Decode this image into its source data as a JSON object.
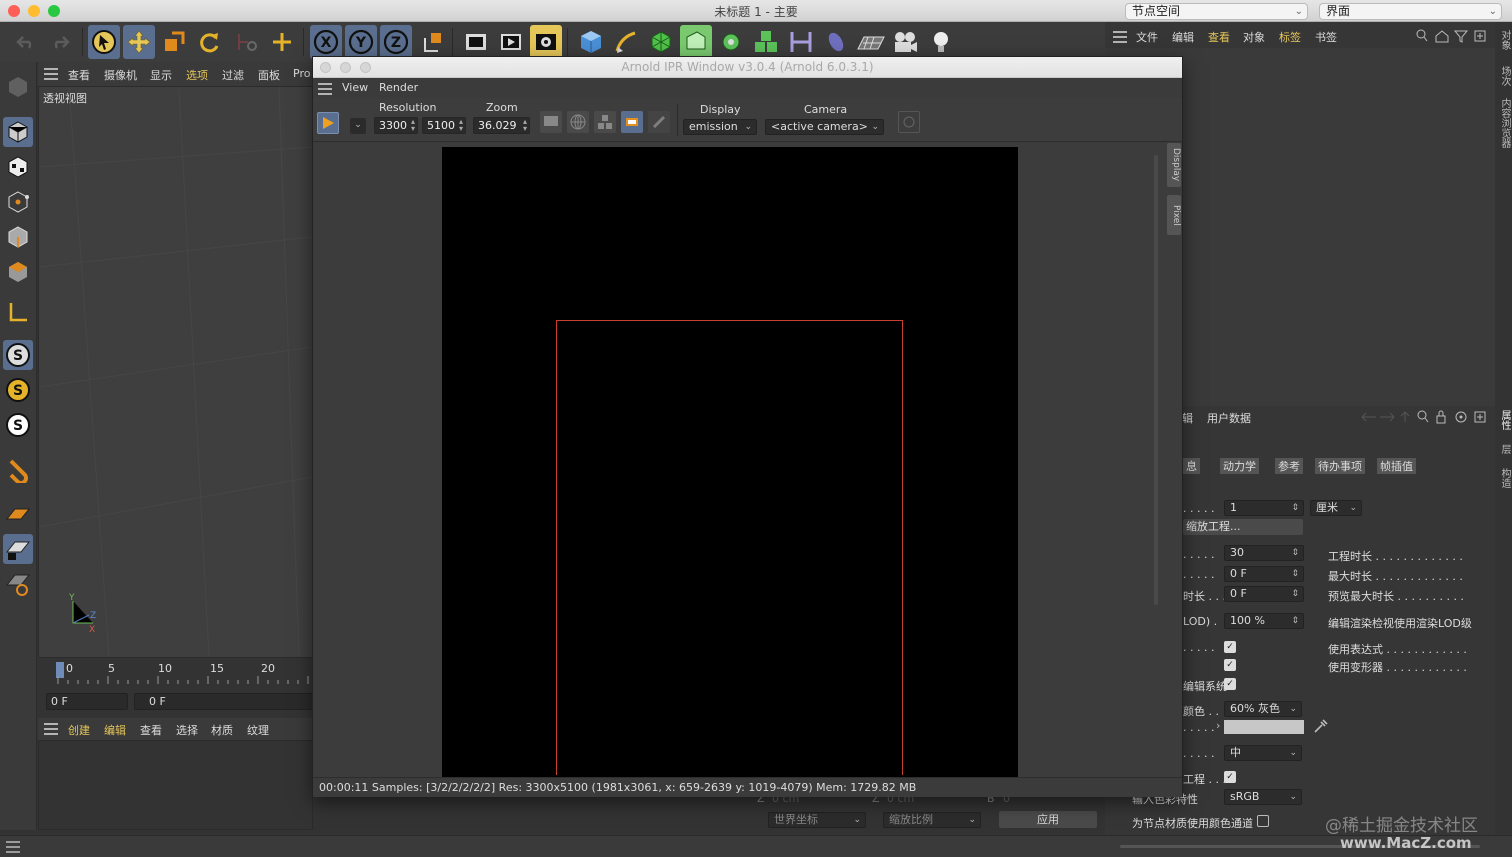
{
  "app": {
    "title": "未标题 1 - 主要",
    "nodespace": "节点空间",
    "layout": "界面"
  },
  "toolbar": {
    "icons": [
      "undo-icon",
      "redo-icon",
      "select-arrow-icon",
      "move-icon",
      "scale-icon",
      "rotate-icon",
      "recent-tool-icon",
      "add-icon",
      "x-axis-icon",
      "y-axis-icon",
      "z-axis-icon",
      "coordinate-system-icon",
      "render-view-icon",
      "render-picture-viewer-icon",
      "render-settings-icon",
      "cube-icon",
      "pen-icon",
      "subdivision-icon",
      "nurbs-icon",
      "cloner-icon",
      "mograph-icon",
      "deformer-icon",
      "field-icon",
      "floor-icon",
      "camera-icon",
      "light-icon"
    ]
  },
  "viewport_menu": {
    "items": [
      "查看",
      "摄像机",
      "显示",
      "选项",
      "过滤",
      "面板",
      "Pro"
    ],
    "label": "透视视图"
  },
  "axis": {
    "y": "Y",
    "z": "Z",
    "x": "X"
  },
  "timeline": {
    "ticks": [
      "0",
      "5",
      "10",
      "15",
      "20"
    ],
    "current_frame": "0 F",
    "start_frame": "0 F"
  },
  "material_menu": {
    "items": [
      "创建",
      "编辑",
      "查看",
      "选择",
      "材质",
      "纹理"
    ]
  },
  "object_menu": {
    "items": [
      "文件",
      "编辑",
      "查看",
      "对象",
      "标签",
      "书签"
    ]
  },
  "right_vtabs": [
    "对象",
    "场次",
    "内容浏览器",
    "属性",
    "层",
    "构造"
  ],
  "attr": {
    "header_tabs": [
      "辑",
      "用户数据"
    ],
    "tabs": [
      "息",
      "动力学",
      "参考",
      "待办事项",
      "帧插值"
    ],
    "rows": [
      {
        "l": ". . . . .",
        "v": "1",
        "unit": "厘米"
      },
      {
        "l": "",
        "btn": "缩放工程..."
      },
      {
        "l": ". . . . .",
        "v": "30",
        "r": "工程时长 . . . . . . . . . . . . ."
      },
      {
        "l": ". . . . .",
        "v": "0 F",
        "r": "最大时长 . . . . . . . . . . . . ."
      },
      {
        "l": "时长 . . .",
        "v": "0 F",
        "r": "预览最大时长 . . . . . . . . . ."
      },
      {
        "l": "LOD) .",
        "v": "100 %",
        "r": "编辑渲染检视使用渲染LOD级"
      },
      {
        "l": ". . . . .",
        "chk": true,
        "r": "使用表达式 . . . . . . . . . . . ."
      },
      {
        "l": "\u0000. . . . .",
        "chk": true,
        "r": "使用变形器 . . . . . . . . . . . ."
      },
      {
        "l": "编辑系统",
        "chk": true
      },
      {
        "l": "颜色 . .",
        "sel": "60% 灰色"
      },
      {
        "l": ". . . . .",
        "swatch": "#c7c7c7"
      },
      {
        "l": ". . . . .",
        "sel": "中"
      },
      {
        "l": "工程 . . .",
        "chk": true
      },
      {
        "l": "输入色彩特性",
        "sel": "sRGB"
      },
      {
        "l": "为节点材质使用颜色通道",
        "chk": false
      }
    ]
  },
  "coord": {
    "world": "世界坐标",
    "scale": "缩放比例",
    "apply": "应用",
    "z1": "Z",
    "z1v": "0 cm",
    "z2": "Z",
    "z2v": "0 cm",
    "b": "B",
    "bv": "0 °"
  },
  "ipr": {
    "title": "Arnold IPR Window v3.0.4 (Arnold 6.0.3.1)",
    "menu": [
      "View",
      "Render"
    ],
    "resolution_label": "Resolution",
    "res_w": "3300",
    "res_h": "5100",
    "zoom_label": "Zoom",
    "zoom": "36.029",
    "display_label": "Display",
    "display": "emission",
    "camera_label": "Camera",
    "camera": "<active camera>",
    "side_tabs": [
      "Display",
      "Pixel"
    ],
    "status": "00:00:11  Samples: [3/2/2/2/2/2]  Res: 3300x5100 (1981x3061, x: 659-2639 y: 1019-4079)  Mem: 1729.82 MB"
  },
  "watermark": {
    "a": "@稀土掘金技术社区",
    "b": "www.MacZ.com"
  },
  "colors": {
    "accent": "#5a6f8f",
    "highlight": "#e5c659",
    "region": "#c8412e"
  }
}
